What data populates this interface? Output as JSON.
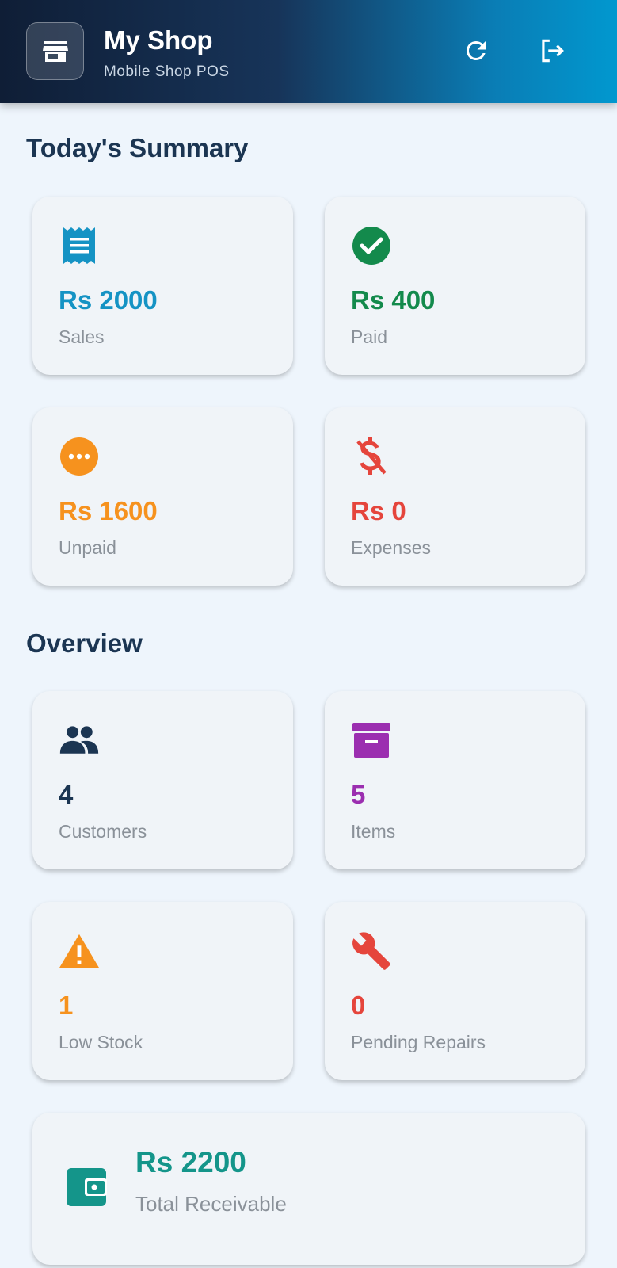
{
  "header": {
    "title": "My Shop",
    "subtitle": "Mobile Shop POS",
    "icons": {
      "logo": "storefront-icon",
      "refresh": "refresh-icon",
      "logout": "logout-icon"
    }
  },
  "summary": {
    "title": "Today's Summary",
    "cards": [
      {
        "value": "Rs 2000",
        "label": "Sales",
        "icon": "receipt-icon",
        "color": "#1593c4"
      },
      {
        "value": "Rs 400",
        "label": "Paid",
        "icon": "check-circle-icon",
        "color": "#138a4c"
      },
      {
        "value": "Rs 1600",
        "label": "Unpaid",
        "icon": "more-circle-icon",
        "color": "#f6921e"
      },
      {
        "value": "Rs 0",
        "label": "Expenses",
        "icon": "money-off-icon",
        "color": "#e5453c"
      }
    ]
  },
  "overview": {
    "title": "Overview",
    "cards": [
      {
        "value": "4",
        "label": "Customers",
        "icon": "people-icon",
        "color": "#1b3552"
      },
      {
        "value": "5",
        "label": "Items",
        "icon": "inventory-box-icon",
        "color": "#9b2eb0"
      },
      {
        "value": "1",
        "label": "Low Stock",
        "icon": "warning-icon",
        "color": "#f6921e"
      },
      {
        "value": "0",
        "label": "Pending Repairs",
        "icon": "wrench-icon",
        "color": "#e5453c"
      }
    ]
  },
  "receivable": {
    "value": "Rs 2200",
    "label": "Total Receivable",
    "icon": "wallet-icon",
    "color": "#14958a"
  }
}
